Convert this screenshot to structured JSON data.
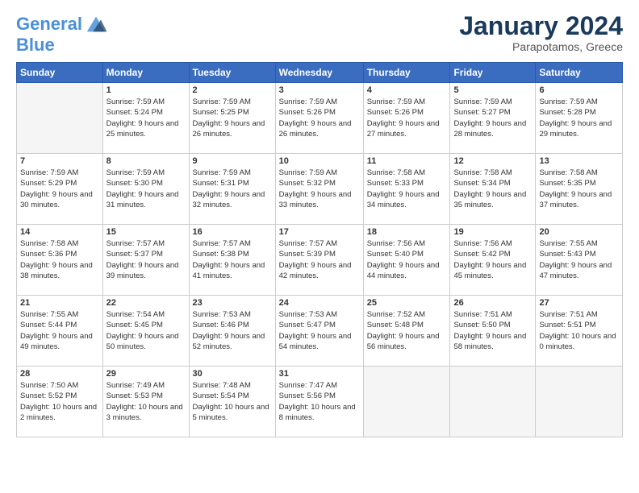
{
  "header": {
    "logo": {
      "line1": "General",
      "line2": "Blue"
    },
    "title": "January 2024",
    "location": "Parapotamos, Greece"
  },
  "days_of_week": [
    "Sunday",
    "Monday",
    "Tuesday",
    "Wednesday",
    "Thursday",
    "Friday",
    "Saturday"
  ],
  "weeks": [
    [
      {
        "day": "",
        "sunrise": "",
        "sunset": "",
        "daylight": "",
        "empty": true
      },
      {
        "day": "1",
        "sunrise": "Sunrise: 7:59 AM",
        "sunset": "Sunset: 5:24 PM",
        "daylight": "Daylight: 9 hours and 25 minutes."
      },
      {
        "day": "2",
        "sunrise": "Sunrise: 7:59 AM",
        "sunset": "Sunset: 5:25 PM",
        "daylight": "Daylight: 9 hours and 26 minutes."
      },
      {
        "day": "3",
        "sunrise": "Sunrise: 7:59 AM",
        "sunset": "Sunset: 5:26 PM",
        "daylight": "Daylight: 9 hours and 26 minutes."
      },
      {
        "day": "4",
        "sunrise": "Sunrise: 7:59 AM",
        "sunset": "Sunset: 5:26 PM",
        "daylight": "Daylight: 9 hours and 27 minutes."
      },
      {
        "day": "5",
        "sunrise": "Sunrise: 7:59 AM",
        "sunset": "Sunset: 5:27 PM",
        "daylight": "Daylight: 9 hours and 28 minutes."
      },
      {
        "day": "6",
        "sunrise": "Sunrise: 7:59 AM",
        "sunset": "Sunset: 5:28 PM",
        "daylight": "Daylight: 9 hours and 29 minutes."
      }
    ],
    [
      {
        "day": "7",
        "sunrise": "Sunrise: 7:59 AM",
        "sunset": "Sunset: 5:29 PM",
        "daylight": "Daylight: 9 hours and 30 minutes."
      },
      {
        "day": "8",
        "sunrise": "Sunrise: 7:59 AM",
        "sunset": "Sunset: 5:30 PM",
        "daylight": "Daylight: 9 hours and 31 minutes."
      },
      {
        "day": "9",
        "sunrise": "Sunrise: 7:59 AM",
        "sunset": "Sunset: 5:31 PM",
        "daylight": "Daylight: 9 hours and 32 minutes."
      },
      {
        "day": "10",
        "sunrise": "Sunrise: 7:59 AM",
        "sunset": "Sunset: 5:32 PM",
        "daylight": "Daylight: 9 hours and 33 minutes."
      },
      {
        "day": "11",
        "sunrise": "Sunrise: 7:58 AM",
        "sunset": "Sunset: 5:33 PM",
        "daylight": "Daylight: 9 hours and 34 minutes."
      },
      {
        "day": "12",
        "sunrise": "Sunrise: 7:58 AM",
        "sunset": "Sunset: 5:34 PM",
        "daylight": "Daylight: 9 hours and 35 minutes."
      },
      {
        "day": "13",
        "sunrise": "Sunrise: 7:58 AM",
        "sunset": "Sunset: 5:35 PM",
        "daylight": "Daylight: 9 hours and 37 minutes."
      }
    ],
    [
      {
        "day": "14",
        "sunrise": "Sunrise: 7:58 AM",
        "sunset": "Sunset: 5:36 PM",
        "daylight": "Daylight: 9 hours and 38 minutes."
      },
      {
        "day": "15",
        "sunrise": "Sunrise: 7:57 AM",
        "sunset": "Sunset: 5:37 PM",
        "daylight": "Daylight: 9 hours and 39 minutes."
      },
      {
        "day": "16",
        "sunrise": "Sunrise: 7:57 AM",
        "sunset": "Sunset: 5:38 PM",
        "daylight": "Daylight: 9 hours and 41 minutes."
      },
      {
        "day": "17",
        "sunrise": "Sunrise: 7:57 AM",
        "sunset": "Sunset: 5:39 PM",
        "daylight": "Daylight: 9 hours and 42 minutes."
      },
      {
        "day": "18",
        "sunrise": "Sunrise: 7:56 AM",
        "sunset": "Sunset: 5:40 PM",
        "daylight": "Daylight: 9 hours and 44 minutes."
      },
      {
        "day": "19",
        "sunrise": "Sunrise: 7:56 AM",
        "sunset": "Sunset: 5:42 PM",
        "daylight": "Daylight: 9 hours and 45 minutes."
      },
      {
        "day": "20",
        "sunrise": "Sunrise: 7:55 AM",
        "sunset": "Sunset: 5:43 PM",
        "daylight": "Daylight: 9 hours and 47 minutes."
      }
    ],
    [
      {
        "day": "21",
        "sunrise": "Sunrise: 7:55 AM",
        "sunset": "Sunset: 5:44 PM",
        "daylight": "Daylight: 9 hours and 49 minutes."
      },
      {
        "day": "22",
        "sunrise": "Sunrise: 7:54 AM",
        "sunset": "Sunset: 5:45 PM",
        "daylight": "Daylight: 9 hours and 50 minutes."
      },
      {
        "day": "23",
        "sunrise": "Sunrise: 7:53 AM",
        "sunset": "Sunset: 5:46 PM",
        "daylight": "Daylight: 9 hours and 52 minutes."
      },
      {
        "day": "24",
        "sunrise": "Sunrise: 7:53 AM",
        "sunset": "Sunset: 5:47 PM",
        "daylight": "Daylight: 9 hours and 54 minutes."
      },
      {
        "day": "25",
        "sunrise": "Sunrise: 7:52 AM",
        "sunset": "Sunset: 5:48 PM",
        "daylight": "Daylight: 9 hours and 56 minutes."
      },
      {
        "day": "26",
        "sunrise": "Sunrise: 7:51 AM",
        "sunset": "Sunset: 5:50 PM",
        "daylight": "Daylight: 9 hours and 58 minutes."
      },
      {
        "day": "27",
        "sunrise": "Sunrise: 7:51 AM",
        "sunset": "Sunset: 5:51 PM",
        "daylight": "Daylight: 10 hours and 0 minutes."
      }
    ],
    [
      {
        "day": "28",
        "sunrise": "Sunrise: 7:50 AM",
        "sunset": "Sunset: 5:52 PM",
        "daylight": "Daylight: 10 hours and 2 minutes."
      },
      {
        "day": "29",
        "sunrise": "Sunrise: 7:49 AM",
        "sunset": "Sunset: 5:53 PM",
        "daylight": "Daylight: 10 hours and 3 minutes."
      },
      {
        "day": "30",
        "sunrise": "Sunrise: 7:48 AM",
        "sunset": "Sunset: 5:54 PM",
        "daylight": "Daylight: 10 hours and 5 minutes."
      },
      {
        "day": "31",
        "sunrise": "Sunrise: 7:47 AM",
        "sunset": "Sunset: 5:56 PM",
        "daylight": "Daylight: 10 hours and 8 minutes."
      },
      {
        "day": "",
        "sunrise": "",
        "sunset": "",
        "daylight": "",
        "empty": true
      },
      {
        "day": "",
        "sunrise": "",
        "sunset": "",
        "daylight": "",
        "empty": true
      },
      {
        "day": "",
        "sunrise": "",
        "sunset": "",
        "daylight": "",
        "empty": true
      }
    ]
  ]
}
